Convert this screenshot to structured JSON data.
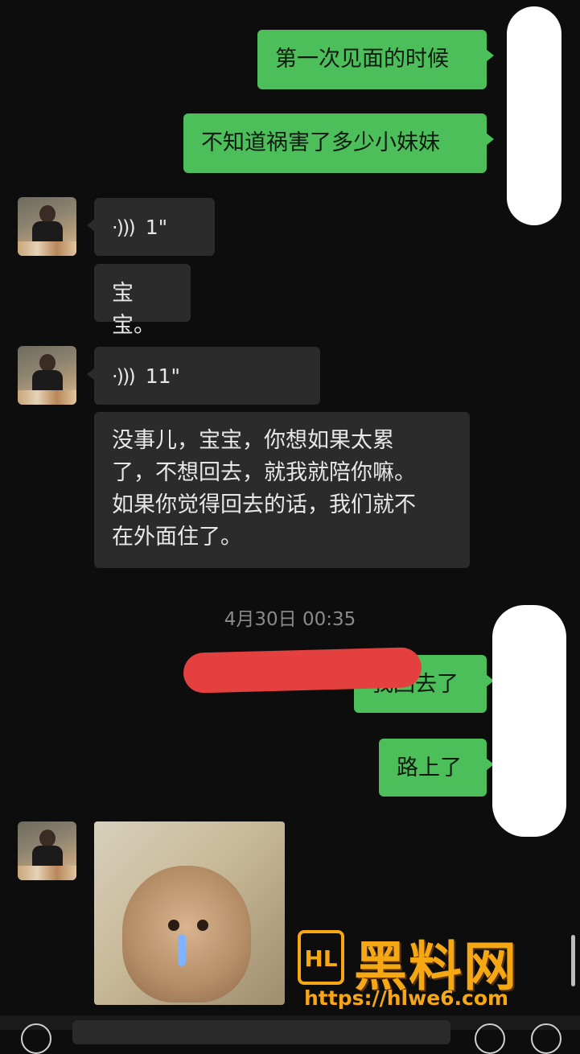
{
  "messages": {
    "m1": "第一次见面的时候",
    "m2": "不知道祸害了多少小妹妹",
    "voice1_duration": "1\"",
    "m3": "宝宝。",
    "voice2_duration": "11\"",
    "m4_line1": "没事儿，宝宝，你想如果太累",
    "m4_line2": "了，不想回去，就我就陪你嘛。",
    "m4_line3": "如果你觉得回去的话，我们就不",
    "m4_line4": "在外面住了。",
    "m5": "我回去了",
    "m6": "路上了"
  },
  "timestamp": "4月30日 00:35",
  "watermark": {
    "logo": "HL",
    "title": "黑料网",
    "url": "https://hlwe6.com"
  }
}
